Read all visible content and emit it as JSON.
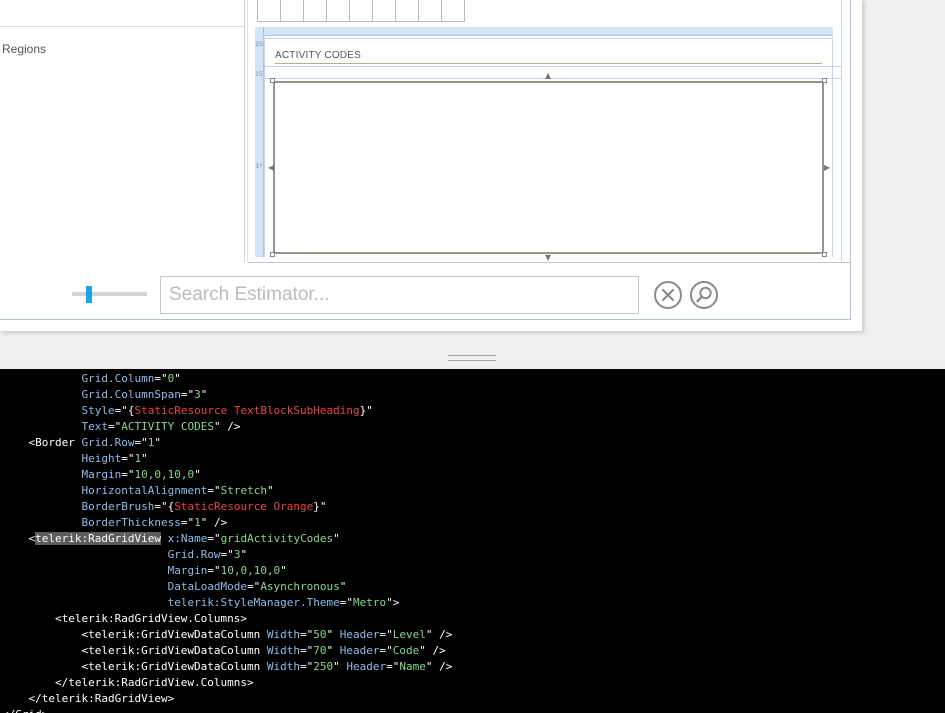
{
  "designer": {
    "regions_label": "Regions",
    "activity_heading": "ACTIVITY CODES",
    "ruler_marks": [
      "25",
      "15",
      "1*"
    ],
    "search": {
      "placeholder": "Search Estimator...",
      "value": ""
    },
    "slider": {
      "level": 0.2
    },
    "icons": {
      "clear": "close-circle-icon",
      "search": "magnifier-icon"
    },
    "colors": {
      "accent": "#1ea1e5",
      "separator": "#d9a46a",
      "ruler": "#d2e4f6"
    }
  },
  "code_lines": [
    [
      [
        "            ",
        "p"
      ],
      [
        "Grid.Column",
        "a"
      ],
      [
        "=\"",
        "p"
      ],
      [
        "0",
        "v"
      ],
      [
        "\"",
        "p"
      ]
    ],
    [
      [
        "            ",
        "p"
      ],
      [
        "Grid.ColumnSpan",
        "a"
      ],
      [
        "=\"",
        "p"
      ],
      [
        "3",
        "v"
      ],
      [
        "\"",
        "p"
      ]
    ],
    [
      [
        "            ",
        "p"
      ],
      [
        "Style",
        "a"
      ],
      [
        "=\"{",
        "p"
      ],
      [
        "StaticResource",
        "r"
      ],
      [
        " TextBlockSubHeading",
        "r"
      ],
      [
        "}\"",
        "p"
      ]
    ],
    [
      [
        "            ",
        "p"
      ],
      [
        "Text",
        "a"
      ],
      [
        "=\"",
        "p"
      ],
      [
        "ACTIVITY CODES",
        "v"
      ],
      [
        "\" />",
        "p"
      ]
    ],
    [
      [
        "    <Border ",
        "p"
      ],
      [
        "Grid.Row",
        "a"
      ],
      [
        "=\"",
        "p"
      ],
      [
        "1",
        "v"
      ],
      [
        "\"",
        "p"
      ]
    ],
    [
      [
        "            ",
        "p"
      ],
      [
        "Height",
        "a"
      ],
      [
        "=\"",
        "p"
      ],
      [
        "1",
        "v"
      ],
      [
        "\"",
        "p"
      ]
    ],
    [
      [
        "            ",
        "p"
      ],
      [
        "Margin",
        "a"
      ],
      [
        "=\"",
        "p"
      ],
      [
        "10,0,10,0",
        "v"
      ],
      [
        "\"",
        "p"
      ]
    ],
    [
      [
        "            ",
        "p"
      ],
      [
        "HorizontalAlignment",
        "a"
      ],
      [
        "=\"",
        "p"
      ],
      [
        "Stretch",
        "v"
      ],
      [
        "\"",
        "p"
      ]
    ],
    [
      [
        "            ",
        "p"
      ],
      [
        "BorderBrush",
        "a"
      ],
      [
        "=\"{",
        "p"
      ],
      [
        "StaticResource",
        "r"
      ],
      [
        " Orange",
        "r"
      ],
      [
        "}\"",
        "p"
      ]
    ],
    [
      [
        "            ",
        "p"
      ],
      [
        "BorderThickness",
        "a"
      ],
      [
        "=\"",
        "p"
      ],
      [
        "1",
        "v"
      ],
      [
        "\" />",
        "p"
      ]
    ],
    [
      [
        "    <",
        "p"
      ],
      [
        "telerik:RadGridView",
        "s"
      ],
      [
        " ",
        "p"
      ],
      [
        "x:Name",
        "a"
      ],
      [
        "=\"",
        "p"
      ],
      [
        "gridActivityCodes",
        "v"
      ],
      [
        "\"",
        "p"
      ]
    ],
    [
      [
        "                         ",
        "p"
      ],
      [
        "Grid.Row",
        "a"
      ],
      [
        "=\"",
        "p"
      ],
      [
        "3",
        "v"
      ],
      [
        "\"",
        "p"
      ]
    ],
    [
      [
        "                         ",
        "p"
      ],
      [
        "Margin",
        "a"
      ],
      [
        "=\"",
        "p"
      ],
      [
        "10,0,10,0",
        "v"
      ],
      [
        "\"",
        "p"
      ]
    ],
    [
      [
        "                         ",
        "p"
      ],
      [
        "DataLoadMode",
        "a"
      ],
      [
        "=\"",
        "p"
      ],
      [
        "Asynchronous",
        "v"
      ],
      [
        "\"",
        "p"
      ]
    ],
    [
      [
        "                         ",
        "p"
      ],
      [
        "telerik:StyleManager.Theme",
        "a"
      ],
      [
        "=\"",
        "p"
      ],
      [
        "Metro",
        "v"
      ],
      [
        "\">",
        "p"
      ]
    ],
    [
      [
        "        <telerik:RadGridView.Columns>",
        "p"
      ]
    ],
    [
      [
        "            <telerik:GridViewDataColumn ",
        "p"
      ],
      [
        "Width",
        "a"
      ],
      [
        "=\"",
        "p"
      ],
      [
        "50",
        "v"
      ],
      [
        "\" ",
        "p"
      ],
      [
        "Header",
        "a"
      ],
      [
        "=\"",
        "p"
      ],
      [
        "Level",
        "v"
      ],
      [
        "\" />",
        "p"
      ]
    ],
    [
      [
        "            <telerik:GridViewDataColumn ",
        "p"
      ],
      [
        "Width",
        "a"
      ],
      [
        "=\"",
        "p"
      ],
      [
        "70",
        "v"
      ],
      [
        "\" ",
        "p"
      ],
      [
        "Header",
        "a"
      ],
      [
        "=\"",
        "p"
      ],
      [
        "Code",
        "v"
      ],
      [
        "\" />",
        "p"
      ]
    ],
    [
      [
        "            <telerik:GridViewDataColumn ",
        "p"
      ],
      [
        "Width",
        "a"
      ],
      [
        "=\"",
        "p"
      ],
      [
        "250",
        "v"
      ],
      [
        "\" ",
        "p"
      ],
      [
        "Header",
        "a"
      ],
      [
        "=\"",
        "p"
      ],
      [
        "Name",
        "v"
      ],
      [
        "\" />",
        "p"
      ]
    ],
    [
      [
        "        </telerik:RadGridView.Columns>",
        "p"
      ]
    ],
    [
      [
        "    </telerik:RadGridView>",
        "p"
      ]
    ],
    [
      [
        "</Grid>",
        "p"
      ]
    ]
  ]
}
